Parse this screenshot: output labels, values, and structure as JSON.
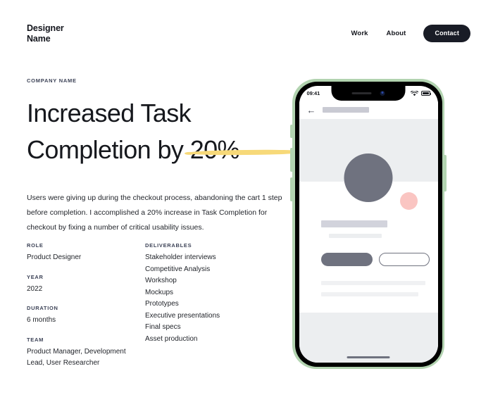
{
  "header": {
    "logo_line1": "Designer",
    "logo_line2": "Name",
    "nav": [
      {
        "label": "Work"
      },
      {
        "label": "About"
      }
    ],
    "contact_label": "Contact",
    "contact_bg": "#191c26"
  },
  "hero": {
    "eyebrow": "COMPANY NAME",
    "headline_line1": "Increased Task",
    "headline_line2": "Completion by 20%",
    "highlight_color": "#f7d979",
    "body": "Users were giving up during the checkout process, abandoning the cart 1 step before completion. I accomplished a 20% increase in Task Completion for checkout by fixing a number of critical usability issues."
  },
  "meta": {
    "role_label": "ROLE",
    "role_value": "Product Designer",
    "year_label": "YEAR",
    "year_value": "2022",
    "duration_label": "DURATION",
    "duration_value": "6 months",
    "team_label": "TEAM",
    "team_value": "Product Manager, Development Lead, User Researcher",
    "deliverables_label": "DELIVERABLES",
    "deliverables": [
      "Stakeholder interviews",
      "Competitive Analysis",
      "Workshop",
      "Mockups",
      "Prototypes",
      "Executive presentations",
      "Final specs",
      "Asset production"
    ]
  },
  "phone": {
    "frame_color": "#b2d3b0",
    "status_time": "09:41",
    "wifi_icon": "wifi-icon",
    "battery_icon": "battery-icon",
    "back_icon": "←",
    "accent_circle_color": "#6f727f",
    "pink_circle_color": "#fac5c2"
  }
}
